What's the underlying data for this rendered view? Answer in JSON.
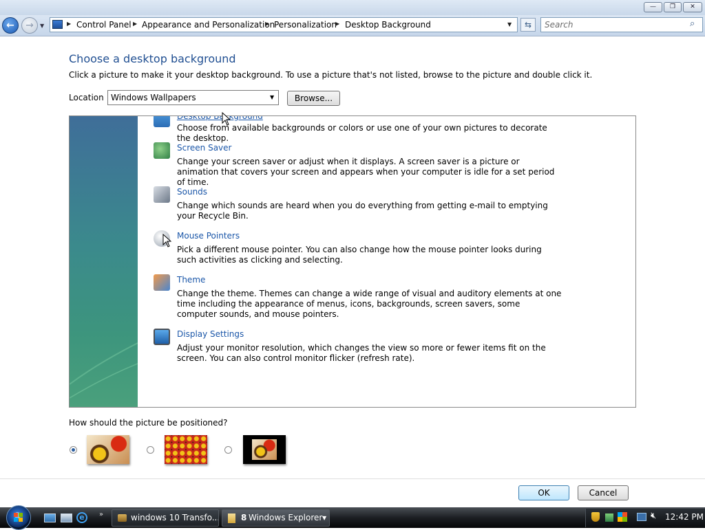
{
  "window": {
    "controls": {
      "minimize": "—",
      "maximize": "❐",
      "close": "✕"
    }
  },
  "nav": {
    "back_icon": "back-arrow-icon",
    "forward_icon": "forward-arrow-icon",
    "breadcrumb": [
      "Control Panel",
      "Appearance and Personalization",
      "Personalization",
      "Desktop Background"
    ],
    "search_placeholder": "Search"
  },
  "main": {
    "heading": "Choose a desktop background",
    "instruction": "Click a picture to make it your desktop background. To use a picture that's not listed, browse to the picture and double click it.",
    "location_label": "Location",
    "location_value": "Windows Wallpapers",
    "browse_label": "Browse...",
    "partial_title": "Desktop Background",
    "items": [
      {
        "title": "",
        "desc": "Choose from available backgrounds or colors or use one of your own pictures to decorate the desktop.",
        "icon": "desktop-background-icon"
      },
      {
        "title": "Screen Saver",
        "desc": "Change your screen saver or adjust when it displays. A screen saver is a picture or animation that covers your screen and appears when your computer is idle for a set period of time.",
        "icon": "screen-saver-icon"
      },
      {
        "title": "Sounds",
        "desc": "Change which sounds are heard when you do everything from getting e-mail to emptying your Recycle Bin.",
        "icon": "sounds-icon"
      },
      {
        "title": "Mouse Pointers",
        "desc": "Pick a different mouse pointer. You can also change how the mouse pointer looks during such activities as clicking and selecting.",
        "icon": "mouse-pointers-icon"
      },
      {
        "title": "Theme",
        "desc": "Change the theme. Themes can change a wide range of visual and auditory elements at one time including the appearance of menus, icons, backgrounds, screen savers, some computer sounds, and mouse pointers.",
        "icon": "theme-icon"
      },
      {
        "title": "Display Settings",
        "desc": "Adjust your monitor resolution, which changes the view so more or fewer items fit on the screen. You can also control monitor flicker (refresh rate).",
        "icon": "display-settings-icon"
      }
    ],
    "position_question": "How should the picture be positioned?",
    "position_options": [
      {
        "name": "Fit to screen",
        "selected": true
      },
      {
        "name": "Tile",
        "selected": false
      },
      {
        "name": "Center",
        "selected": false
      }
    ]
  },
  "footer": {
    "ok": "OK",
    "cancel": "Cancel"
  },
  "taskbar": {
    "task1": "windows 10 Transfo...",
    "task2_count": "8",
    "task2_label": "Windows Explorer",
    "clock": "12:42 PM"
  },
  "colors": {
    "link": "#1a56a8",
    "heading": "#1f4e91",
    "panel": "#3d8b8a"
  }
}
